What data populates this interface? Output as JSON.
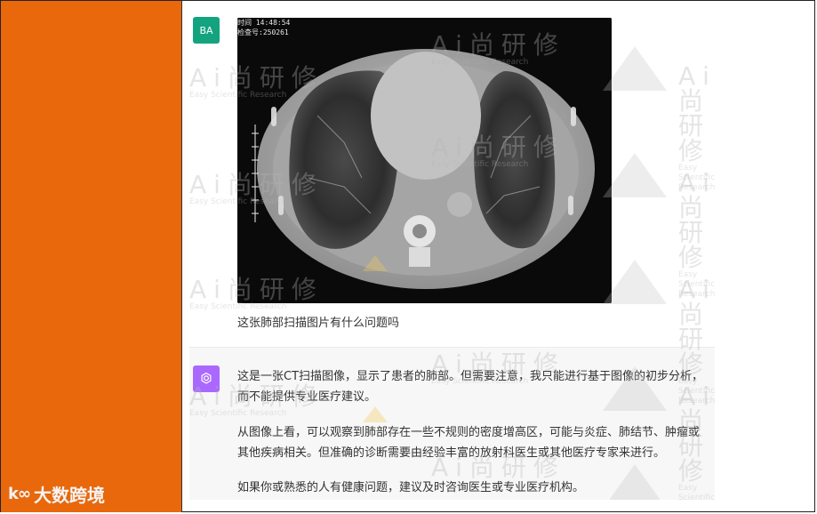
{
  "sidebar": {
    "brand": "大数跨境",
    "brand_logo": "k∞",
    "color": "#e8680b"
  },
  "chat": {
    "user": {
      "avatar": "BA",
      "avatar_color": "#14a37f",
      "image_alt_line1": "时间 14:48:54",
      "image_alt_line2": "检查号:250261",
      "message": "这张肺部扫描图片有什么问题吗"
    },
    "assistant": {
      "avatar_icon": "chatgpt-icon",
      "avatar_color": "#ab68ff",
      "paragraphs": [
        "这是一张CT扫描图像，显示了患者的肺部。但需要注意，我只能进行基于图像的初步分析，而不能提供专业医疗建议。",
        "从图像上看，可以观察到肺部存在一些不规则的密度增高区，可能与炎症、肺结节、肿瘤或其他疾病相关。但准确的诊断需要由经验丰富的放射科医生或其他医疗专家来进行。",
        "如果你或熟悉的人有健康问题，建议及时咨询医生或专业医疗机构。"
      ]
    }
  },
  "watermark": {
    "title": "Ai尚研修",
    "subtitle": "Easy Scientific Research"
  }
}
